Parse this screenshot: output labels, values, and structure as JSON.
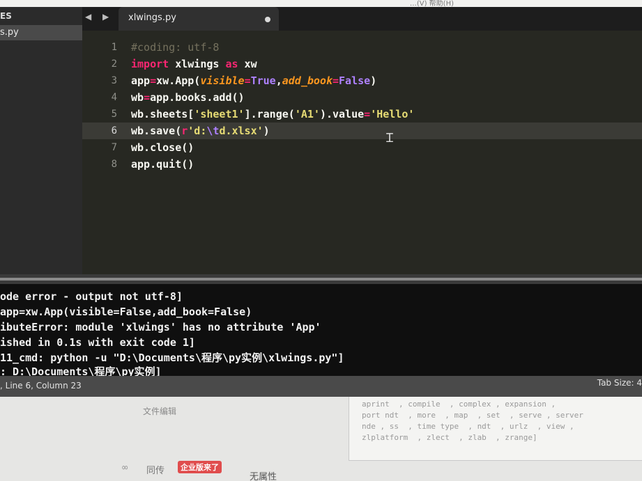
{
  "top_strip_text": "…(V)  帮助(H)",
  "sidebar": {
    "header": "ES",
    "file": "s.py"
  },
  "tabbar": {
    "arrows": "◀ ▶",
    "tab_title": "xlwings.py"
  },
  "code": {
    "line_numbers": [
      "1",
      "2",
      "3",
      "4",
      "5",
      "6",
      "7",
      "8"
    ],
    "current_line": 6
  },
  "output": {
    "lines": [
      "ode error - output not utf-8]",
      "app=xw.App(visible=False,add_book=False)",
      "ibuteError: module 'xlwings' has no attribute 'App'",
      "ished in 0.1s with exit code 1]",
      "11_cmd: python -u \"D:\\Documents\\程序\\py实例\\xlwings.py\"]",
      ": D:\\Documents\\程序\\py实例]"
    ]
  },
  "status": {
    "left": ", Line 6, Column 23",
    "right": "Tab Size: 4"
  },
  "below": {
    "label1": "文件编辑",
    "label2": "同传",
    "badge": "企业版来了",
    "label3": "无属性",
    "doc_lines": [
      "aprint  , compile  , complex , expansion , ",
      "port ndt  , more  , map  , set  , serve , server",
      "nde , ss  , time type  , ndt  , urlz  , view , ",
      "zlplatform  , zlect  , zlab  , zrange]"
    ]
  }
}
